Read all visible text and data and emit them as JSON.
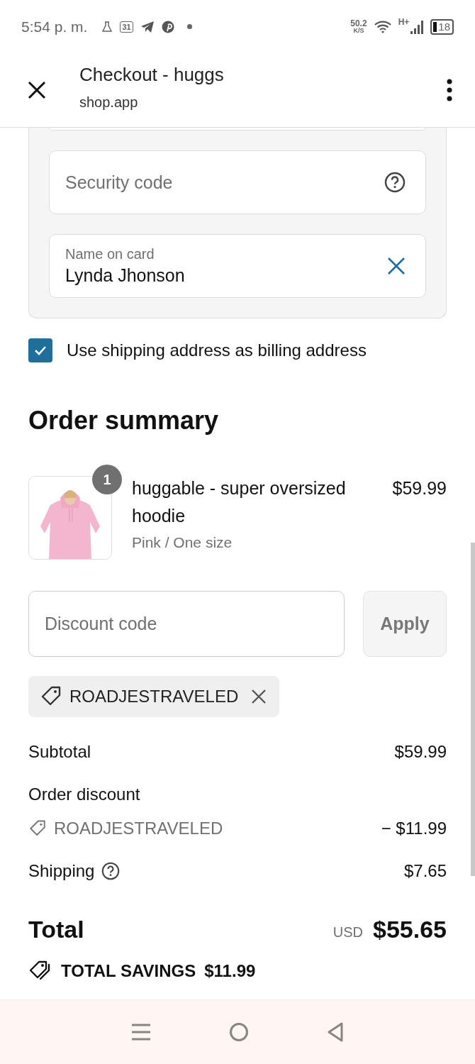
{
  "status_bar": {
    "time": "5:54 p. m.",
    "calendar_day": "31",
    "network_speed": "50.2",
    "speed_unit": "K/S",
    "network_type": "H+",
    "battery": "18"
  },
  "app_bar": {
    "title": "Checkout - huggs",
    "subtitle": "shop.app"
  },
  "payment_fields": [
    {
      "kind": "help",
      "placeholder": "Security code"
    },
    {
      "kind": "clearable",
      "label": "Name on card",
      "value": "Lynda Jhonson"
    }
  ],
  "billing_checkbox": {
    "label": "Use shipping address as billing address",
    "checked": true
  },
  "order_summary": {
    "title": "Order summary",
    "items": [
      {
        "name": "huggable - super oversized hoodie",
        "variant": "Pink / One size",
        "price": "$59.99",
        "quantity": "1"
      }
    ],
    "discount_field": {
      "placeholder": "Discount code"
    },
    "apply_button": {
      "label": "Apply",
      "disabled": true
    },
    "applied_codes": [
      {
        "code": "ROADJESTRAVELED"
      }
    ],
    "lines": [
      {
        "kind": "plain",
        "label": "Subtotal",
        "amount": "$59.99"
      },
      {
        "kind": "heading",
        "label": "Order discount"
      },
      {
        "kind": "code",
        "label": "ROADJESTRAVELED",
        "amount": "− $11.99"
      },
      {
        "kind": "help",
        "label": "Shipping",
        "amount": "$7.65"
      }
    ],
    "total": {
      "label": "Total",
      "currency": "USD",
      "amount": "$55.65"
    },
    "savings": {
      "label": "TOTAL SAVINGS",
      "amount": "$11.99"
    }
  }
}
